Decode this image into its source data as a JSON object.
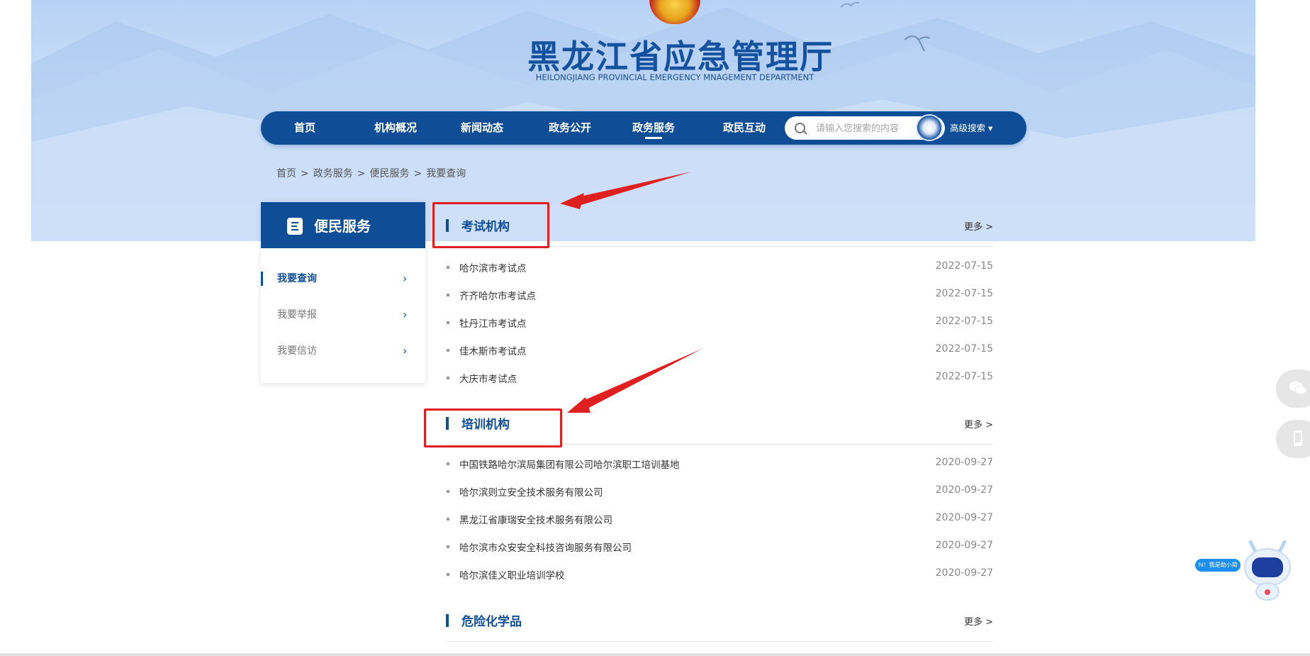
{
  "header": {
    "title_cn": "黑龙江省应急管理厅",
    "title_en": "HEILONGJIANG PROVINCIAL EMERGENCY MNAGEMENT DEPARTMENT"
  },
  "nav": {
    "items": [
      {
        "label": "首页"
      },
      {
        "label": "机构概况"
      },
      {
        "label": "新闻动态"
      },
      {
        "label": "政务公开"
      },
      {
        "label": "政务服务"
      },
      {
        "label": "政民互动"
      }
    ],
    "active": "政务服务",
    "search_placeholder": "请输入您搜索的内容",
    "advanced_search": "高级搜索 ▾"
  },
  "breadcrumb": [
    "首页",
    ">",
    "政务服务",
    ">",
    "便民服务",
    ">",
    "我要查询"
  ],
  "sidebar": {
    "title": "便民服务",
    "items": [
      {
        "label": "我要查询",
        "active": true
      },
      {
        "label": "我要举报",
        "active": false
      },
      {
        "label": "我要信访",
        "active": false
      }
    ]
  },
  "sections": [
    {
      "title": "考试机构",
      "more": "更多 >",
      "rows": [
        {
          "text": "哈尔滨市考试点",
          "date": "2022-07-15"
        },
        {
          "text": "齐齐哈尔市考试点",
          "date": "2022-07-15"
        },
        {
          "text": "牡丹江市考试点",
          "date": "2022-07-15"
        },
        {
          "text": "佳木斯市考试点",
          "date": "2022-07-15"
        },
        {
          "text": "大庆市考试点",
          "date": "2022-07-15"
        }
      ]
    },
    {
      "title": "培训机构",
      "more": "更多 >",
      "rows": [
        {
          "text": "中国铁路哈尔滨局集团有限公司哈尔滨职工培训基地",
          "date": "2020-09-27"
        },
        {
          "text": "哈尔滨则立安全技术服务有限公司",
          "date": "2020-09-27"
        },
        {
          "text": "黑龙江省康瑞安全技术服务有限公司",
          "date": "2020-09-27"
        },
        {
          "text": "哈尔滨市众安安全科技咨询服务有限公司",
          "date": "2020-09-27"
        },
        {
          "text": "哈尔滨佳义职业培训学校",
          "date": "2020-09-27"
        }
      ]
    },
    {
      "title": "危险化学品",
      "more": "更多 >",
      "rows": []
    }
  ],
  "assistant": {
    "bubble": "hi！我是助小简"
  },
  "colors": {
    "brand": "#0f4e97",
    "annotation": "#e02020"
  }
}
